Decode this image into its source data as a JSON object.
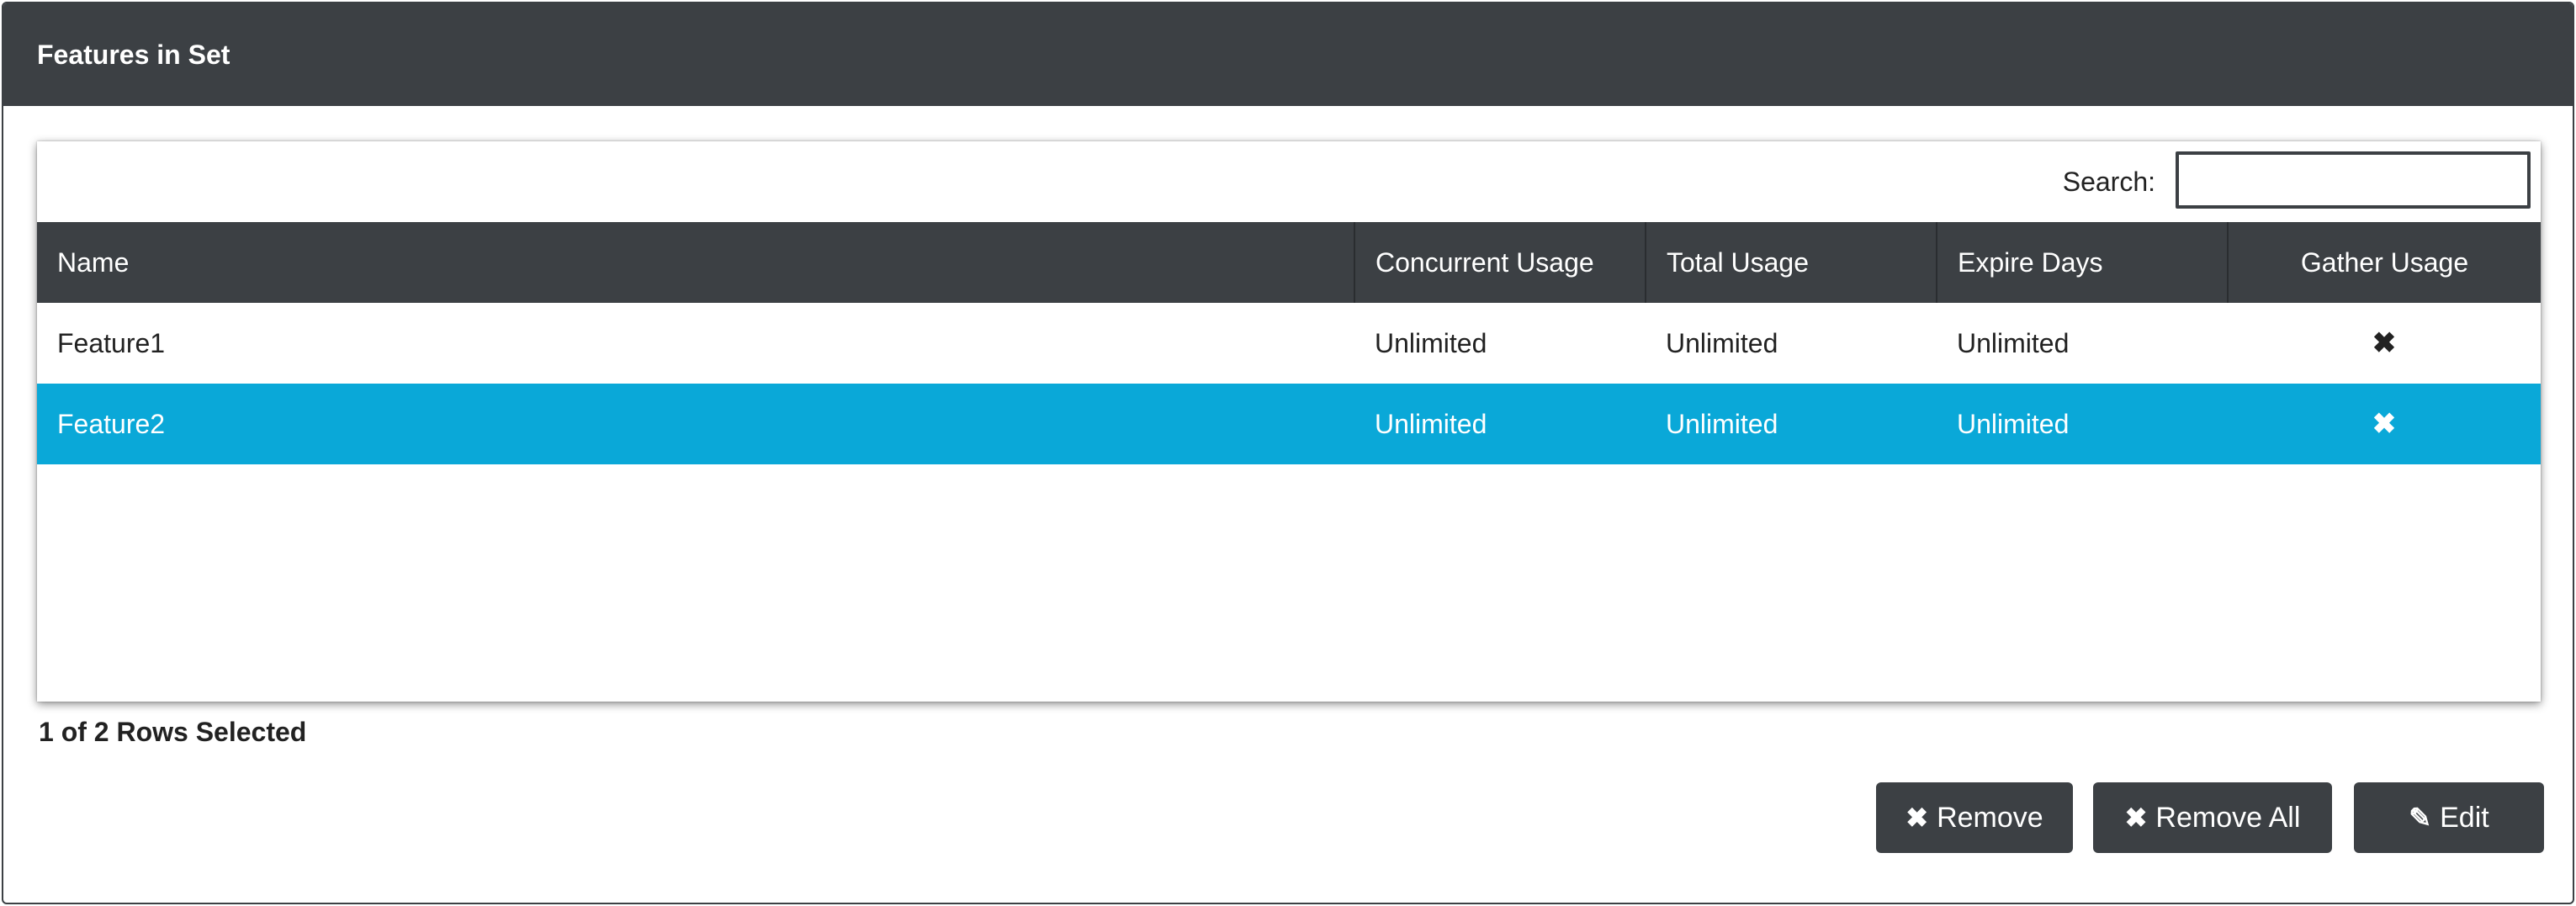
{
  "panel": {
    "title": "Features in Set"
  },
  "search": {
    "label": "Search:",
    "value": "",
    "placeholder": ""
  },
  "table": {
    "columns": [
      "Name",
      "Concurrent Usage",
      "Total Usage",
      "Expire Days",
      "Gather Usage"
    ],
    "rows": [
      {
        "name": "Feature1",
        "concurrent": "Unlimited",
        "total": "Unlimited",
        "expire": "Unlimited",
        "gather_icon": "x-icon",
        "gather": "✖",
        "selected": false
      },
      {
        "name": "Feature2",
        "concurrent": "Unlimited",
        "total": "Unlimited",
        "expire": "Unlimited",
        "gather_icon": "x-icon",
        "gather": "✖",
        "selected": true
      }
    ]
  },
  "status": {
    "text": "1 of 2 Rows Selected"
  },
  "buttons": {
    "remove": {
      "label": "Remove",
      "icon": "✖"
    },
    "remove_all": {
      "label": "Remove All",
      "icon": "✖"
    },
    "edit": {
      "label": "Edit",
      "icon": "✎"
    }
  },
  "colors": {
    "header_bg": "#3c4044",
    "selected_row": "#0aa8d8"
  }
}
